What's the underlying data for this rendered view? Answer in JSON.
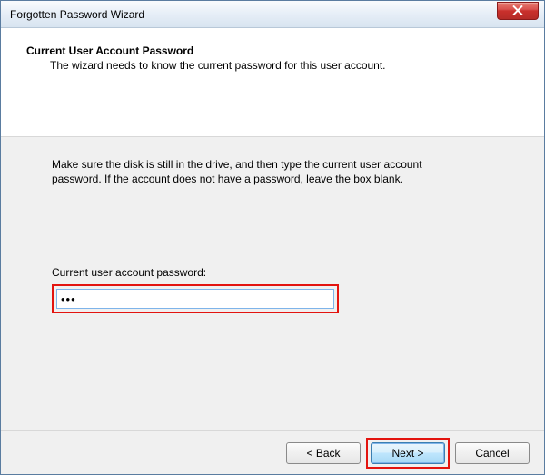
{
  "window": {
    "title": "Forgotten Password Wizard"
  },
  "header": {
    "heading": "Current User Account Password",
    "subtext": "The wizard needs to know the current password for this user account."
  },
  "body": {
    "instruction": "Make sure the disk is still in the drive, and then type the current user account password. If the account does not have a password, leave the box blank.",
    "field_label": "Current user account password:",
    "password_value": "•••"
  },
  "footer": {
    "back_label": "< Back",
    "next_label": "Next >",
    "cancel_label": "Cancel"
  }
}
